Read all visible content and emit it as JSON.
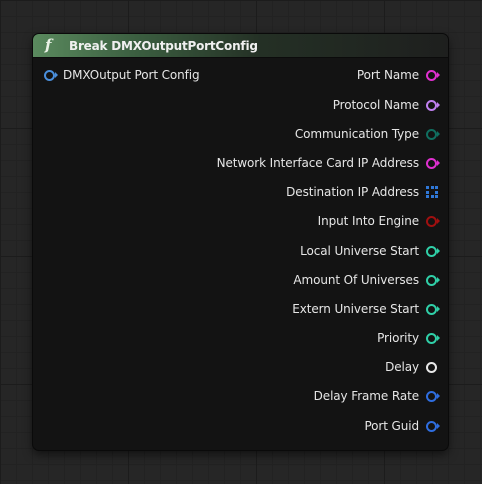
{
  "node": {
    "title": "Break DMXOutputPortConfig",
    "icon": "function-icon",
    "header_color": "#5a8a5e"
  },
  "input_pin": {
    "label": "DMXOutput Port Config",
    "color": "#4a8fdc",
    "shape": "circle-with-arrow"
  },
  "output_pins": [
    {
      "label": "Port Name",
      "color": "#e030d0",
      "shape": "circle-with-arrow"
    },
    {
      "label": "Protocol Name",
      "color": "#c080f0",
      "shape": "circle-with-arrow"
    },
    {
      "label": "Communication Type",
      "color": "#106f60",
      "shape": "circle-with-arrow"
    },
    {
      "label": "Network Interface Card IP Address",
      "color": "#e030d0",
      "shape": "circle-with-arrow"
    },
    {
      "label": "Destination IP Address",
      "color": "#2f78d8",
      "shape": "array-grid"
    },
    {
      "label": "Input Into Engine",
      "color": "#a01010",
      "shape": "circle-with-arrow"
    },
    {
      "label": "Local Universe Start",
      "color": "#30d0a8",
      "shape": "circle-with-arrow"
    },
    {
      "label": "Amount Of Universes",
      "color": "#30d0a8",
      "shape": "circle-with-arrow"
    },
    {
      "label": "Extern Universe Start",
      "color": "#30d0a8",
      "shape": "circle-with-arrow"
    },
    {
      "label": "Priority",
      "color": "#30d0a8",
      "shape": "circle-with-arrow"
    },
    {
      "label": "Delay",
      "color": "#e8e8e8",
      "shape": "circle"
    },
    {
      "label": "Delay Frame Rate",
      "color": "#2f6ee0",
      "shape": "circle-with-arrow"
    },
    {
      "label": "Port Guid",
      "color": "#2f6ee0",
      "shape": "circle-with-arrow"
    }
  ]
}
